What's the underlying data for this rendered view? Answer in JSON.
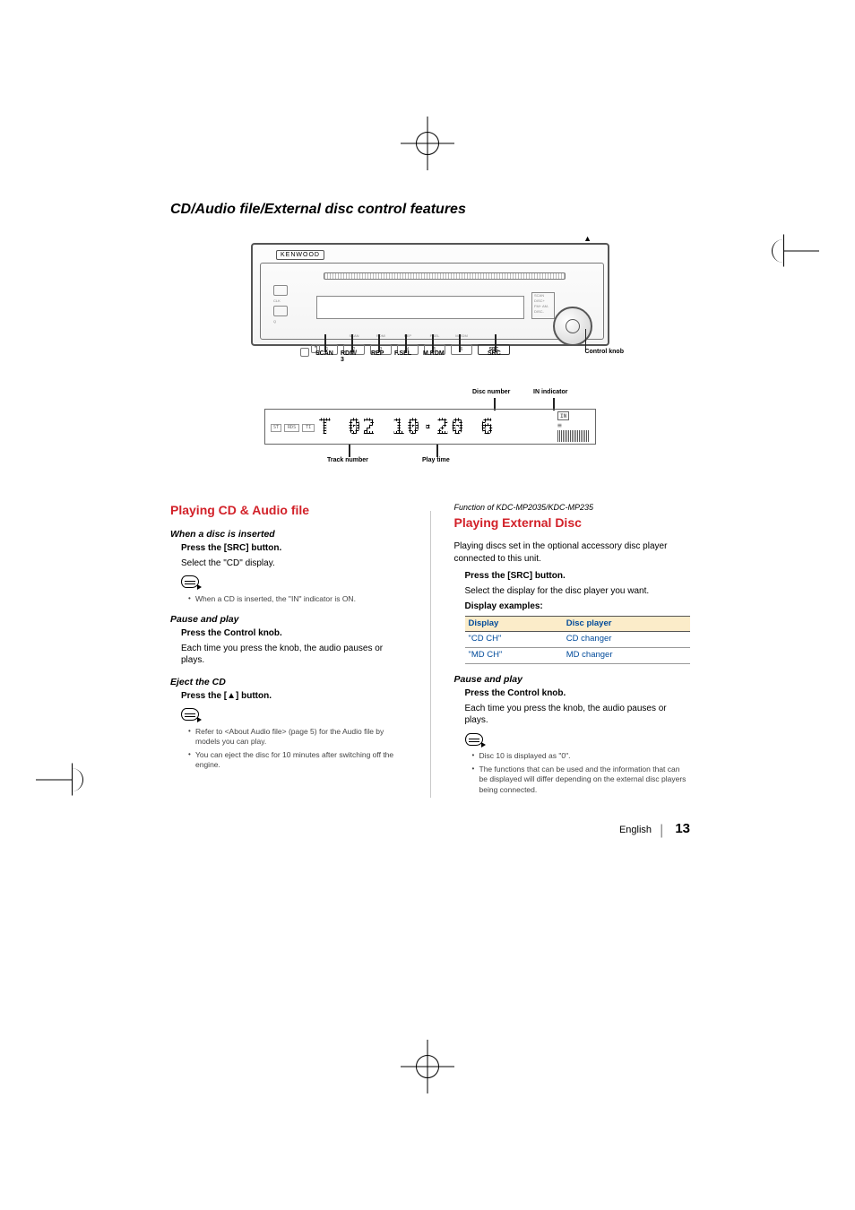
{
  "section_title": "CD/Audio file/External disc control features",
  "figure": {
    "brand": "KENWOOD",
    "eject_glyph": "▲",
    "side_screen_lines": [
      "SCAN",
      "DISC+",
      "FM+ AM-",
      "DISC-"
    ],
    "row_tiny_labels": [
      "SCAN",
      "RDM/",
      "REP",
      "F.SEL",
      "M.RDM"
    ],
    "preset_nums": [
      "1",
      "2",
      "3",
      "4",
      "5",
      "6"
    ],
    "src_label": "SRC",
    "star": "*",
    "att": "ATT",
    "left_col": [
      "CLK",
      "",
      "Q"
    ],
    "callouts": {
      "scan": "SCAN",
      "rdm": "RDM/\n3",
      "rep": "REP",
      "fsel": "F.SEL",
      "mrdm": "M.RDM",
      "src": "SRC",
      "knob": "Control knob"
    }
  },
  "lcd": {
    "left_badges": [
      "ST",
      "RDS",
      "TI"
    ],
    "readout": "T 02 10·20 6",
    "in_badge": "IN",
    "callouts": {
      "disc_number": "Disc number",
      "in_indicator": "IN indicator",
      "track_number": "Track number",
      "play_time": "Play time"
    }
  },
  "left_col": {
    "heading": "Playing CD & Audio file",
    "s1": {
      "title": "When a disc is inserted",
      "bold": "Press the [SRC] button.",
      "body": "Select the \"CD\" display.",
      "note": "When a CD is inserted, the \"IN\" indicator is ON."
    },
    "s2": {
      "title": "Pause and play",
      "bold": "Press the Control knob.",
      "body": "Each time you press the knob, the audio pauses or plays."
    },
    "s3": {
      "title": "Eject the CD",
      "bold": "Press the [▲] button.",
      "notes": [
        "Refer to <About Audio file> (page 5) for the Audio file by models you can play.",
        "You can eject the disc for 10 minutes after switching off the engine."
      ]
    }
  },
  "right_col": {
    "func_note": "Function of KDC-MP2035/KDC-MP235",
    "heading": "Playing External Disc",
    "intro": "Playing discs set in the optional accessory disc player connected to this unit.",
    "bold": "Press the [SRC] button.",
    "body": "Select the display for the disc player you want.",
    "examples_label": "Display examples:",
    "table": {
      "headers": [
        "Display",
        "Disc player"
      ],
      "rows": [
        [
          "\"CD CH\"",
          "CD changer"
        ],
        [
          "\"MD CH\"",
          "MD changer"
        ]
      ]
    },
    "s2": {
      "title": "Pause and play",
      "bold": "Press the Control knob.",
      "body": "Each time you press the knob, the audio pauses or plays."
    },
    "notes": [
      "Disc 10 is displayed as \"0\".",
      "The functions that can be used and the information that can be displayed will differ depending on the external disc players being connected."
    ]
  },
  "footer": {
    "lang": "English",
    "page": "13"
  }
}
